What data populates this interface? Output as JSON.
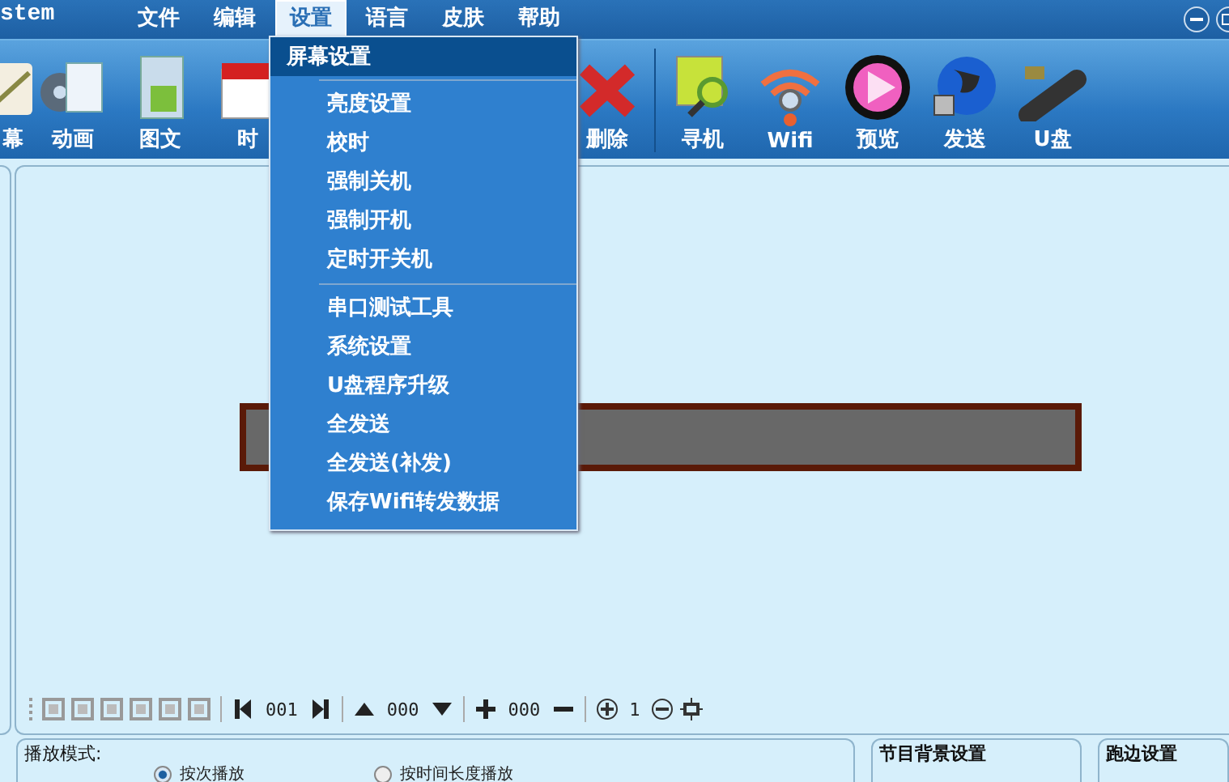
{
  "app_title": "stem",
  "menus": [
    {
      "label": "文件",
      "selected": false
    },
    {
      "label": "编辑",
      "selected": false
    },
    {
      "label": "设置",
      "selected": true
    },
    {
      "label": "语言",
      "selected": false
    },
    {
      "label": "皮肤",
      "selected": false
    },
    {
      "label": "帮助",
      "selected": false
    }
  ],
  "toolbar_left": [
    {
      "label": "幕",
      "kind": "screen"
    },
    {
      "label": "动画",
      "kind": "film"
    },
    {
      "label": "图文",
      "kind": "folder"
    },
    {
      "label": "时",
      "kind": "calendar"
    }
  ],
  "toolbar_right": [
    {
      "label": "删除",
      "kind": "delete"
    },
    {
      "label": "寻机",
      "kind": "monitor"
    },
    {
      "label": "Wifi",
      "kind": "wifi"
    },
    {
      "label": "预览",
      "kind": "play"
    },
    {
      "label": "发送",
      "kind": "globe"
    },
    {
      "label": "U盘",
      "kind": "usb"
    }
  ],
  "dropdown": {
    "header": "屏幕设置",
    "items": [
      {
        "label": "亮度设置",
        "separator_before": true
      },
      {
        "label": "校时",
        "separator_before": false
      },
      {
        "label": "强制关机",
        "separator_before": false
      },
      {
        "label": "强制开机",
        "separator_before": false
      },
      {
        "label": "定时开关机",
        "separator_before": false
      },
      {
        "label": "串口测试工具",
        "separator_before": true
      },
      {
        "label": "系统设置",
        "separator_before": false
      },
      {
        "label": "U盘程序升级",
        "separator_before": false
      },
      {
        "label": "全发送",
        "separator_before": false
      },
      {
        "label": "全发送(补发)",
        "separator_before": false
      },
      {
        "label": "保存Wifi转发数据",
        "separator_before": false
      }
    ]
  },
  "edit_toolbar": {
    "page": "001",
    "up_value": "000",
    "add_value": "000",
    "zoom": "1"
  },
  "play_panel": {
    "title": "播放模式:",
    "options": [
      {
        "label": "按次播放",
        "selected": true
      },
      {
        "label": "按时间长度播放",
        "selected": false
      }
    ]
  },
  "background_panel": {
    "title": "节目背景设置"
  },
  "border_panel": {
    "title": "跑边设置"
  }
}
